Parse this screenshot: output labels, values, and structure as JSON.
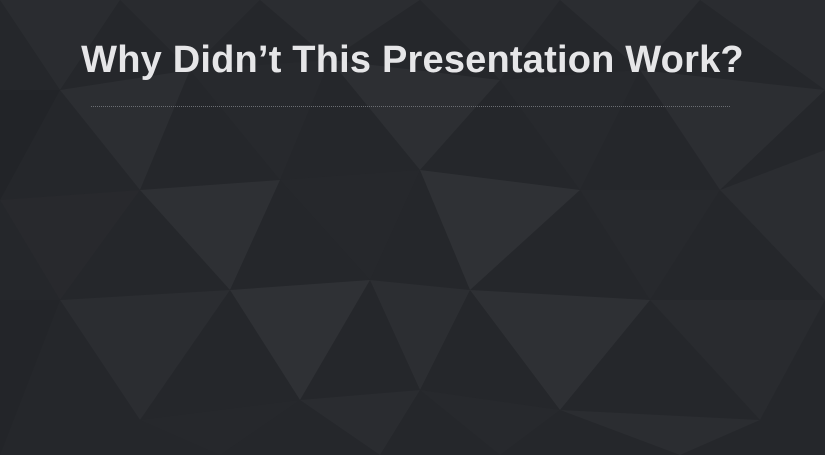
{
  "slide": {
    "title": "Why Didn’t This Presentation Work?"
  },
  "colors": {
    "background": "#26282c",
    "title_text": "#e6e6e8",
    "divider": "#6a6d72"
  }
}
